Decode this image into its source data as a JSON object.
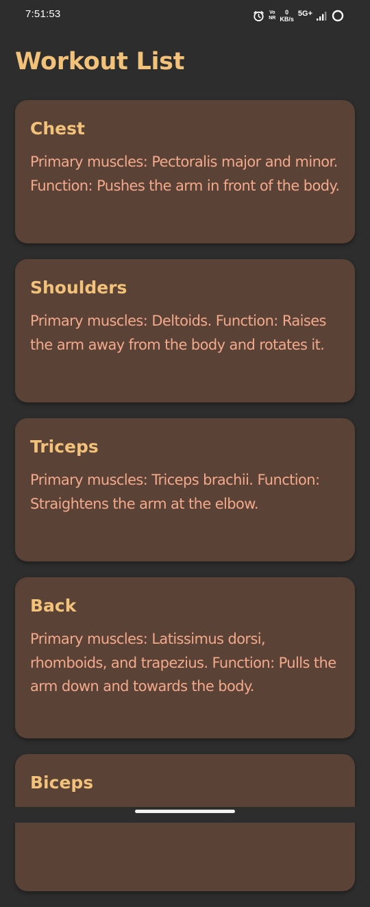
{
  "status_bar": {
    "time": "7:51:53",
    "volte_top": "Vo",
    "volte_bottom": "NR",
    "speed_value": "0",
    "speed_unit": "KB/s",
    "network": "5G+",
    "icons": [
      "alarm-icon",
      "signal-icon",
      "circle-icon"
    ]
  },
  "title": "Workout List",
  "workouts": [
    {
      "name": "Chest",
      "description": "Primary muscles: Pectoralis major and minor. Function: Pushes the arm in front of the body."
    },
    {
      "name": "Shoulders",
      "description": "Primary muscles: Deltoids. Function: Raises the arm away from the body and rotates it."
    },
    {
      "name": "Triceps",
      "description": "Primary muscles: Triceps brachii. Function: Straightens the arm at the elbow."
    },
    {
      "name": "Back",
      "description": "Primary muscles: Latissimus dorsi, rhomboids, and trapezius. Function: Pulls the arm down and towards the body."
    },
    {
      "name": "Biceps",
      "description": ""
    }
  ],
  "colors": {
    "background": "#2d2d2d",
    "card": "#5b4236",
    "title": "#f2c27b",
    "description": "#f3a98b"
  }
}
